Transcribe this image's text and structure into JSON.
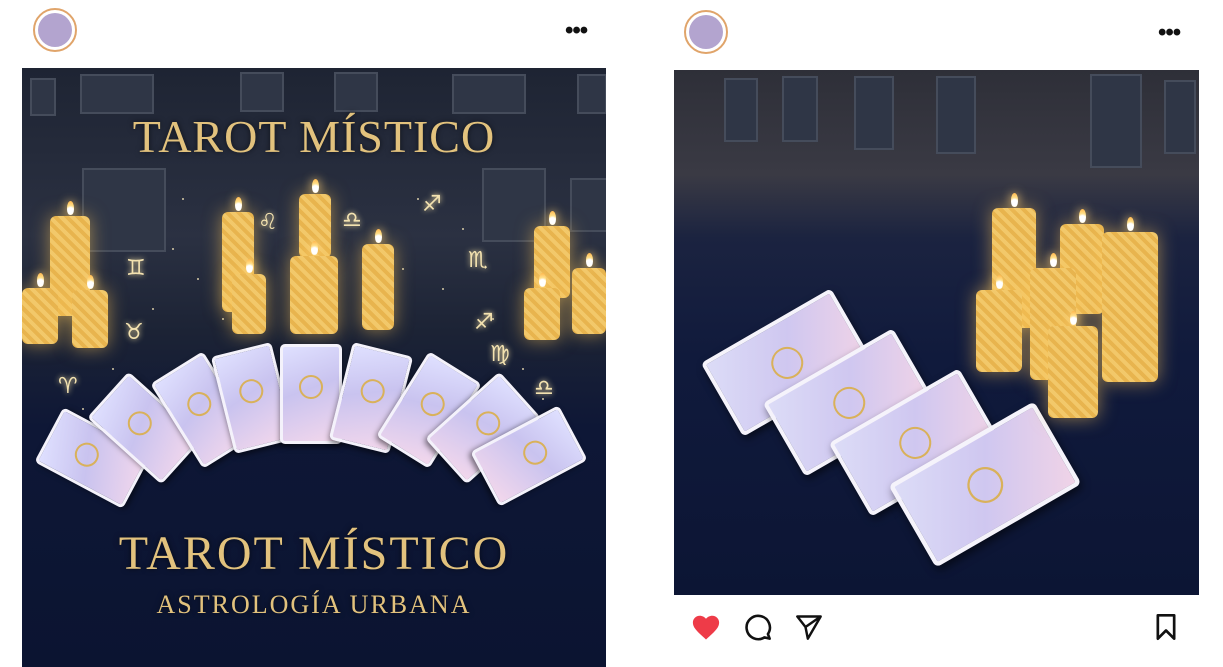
{
  "posts": [
    {
      "more_label": "•••",
      "image": {
        "title_top": "TAROT MÍSTICO",
        "title_bottom": "TAROT MÍSTICO",
        "subtitle": "ASTROLOGÍA URBANA"
      },
      "zodiac_symbols": [
        "♊",
        "♉",
        "♈",
        "♌",
        "♎",
        "♐",
        "♏",
        "♐",
        "♍",
        "♎"
      ]
    },
    {
      "more_label": "•••",
      "actions": {
        "like_icon": "heart-icon",
        "comment_icon": "comment-bubble-icon",
        "share_icon": "paper-plane-icon",
        "save_icon": "bookmark-icon"
      }
    }
  ],
  "colors": {
    "avatar_fill": "#b3a4cf",
    "avatar_ring": "#e0a46a",
    "gold_text": "#e2c27d",
    "like_red": "#ee3b48"
  }
}
